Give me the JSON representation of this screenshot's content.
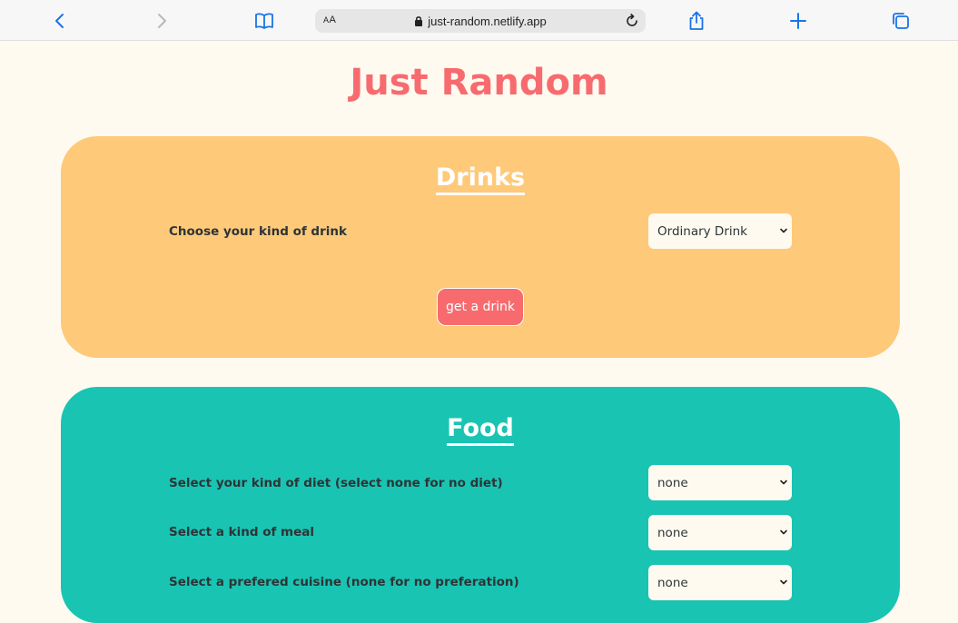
{
  "browser": {
    "aa_label_big": "A",
    "aa_label_small": "A",
    "url": "just-random.netlify.app"
  },
  "page": {
    "title": "Just Random"
  },
  "drinks": {
    "heading": "Drinks",
    "kind_label": "Choose your kind of drink",
    "kind_value": "Ordinary Drink",
    "button_label": "get a drink"
  },
  "food": {
    "heading": "Food",
    "diet_label": "Select your kind of diet (select none for no diet)",
    "diet_value": "none",
    "meal_label": "Select a kind of meal",
    "meal_value": "none",
    "cuisine_label": "Select a prefered cuisine (none for no preferation)",
    "cuisine_value": "none"
  },
  "colors": {
    "accent": "#f76b6f",
    "drinks_card": "#fec979",
    "food_card": "#19c4b3",
    "browser_blue": "#1a73e8"
  }
}
